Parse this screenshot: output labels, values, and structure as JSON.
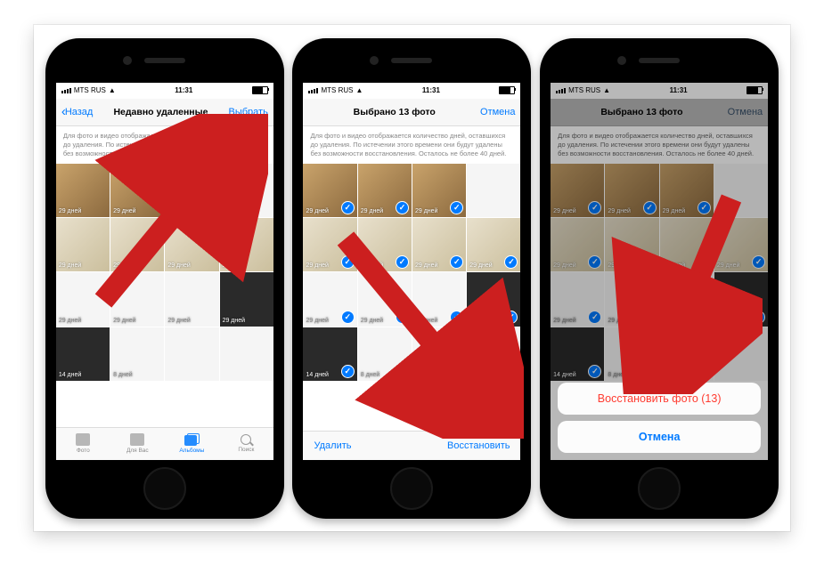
{
  "status": {
    "carrier": "MTS RUS",
    "wifi_icon": "wifi",
    "time": "11:31",
    "battery_icon": "battery"
  },
  "description": "Для фото и видео отображается количество дней, оставшихся до удаления. По истечении этого времени они будут удалены без возможности восстановления. Осталось не более 40 дней.",
  "day_labels": {
    "d29": "29 дней",
    "d14": "14 дней",
    "d8": "8 дней"
  },
  "phone1": {
    "nav_back": "Назад",
    "nav_title": "Недавно удаленные",
    "nav_action": "Выбрать",
    "tabs": {
      "photos": "Фото",
      "for_you": "Для Вас",
      "albums": "Альбомы",
      "search": "Поиск"
    }
  },
  "phone2": {
    "nav_title": "Выбрано 13 фото",
    "nav_action": "Отмена",
    "toolbar_delete": "Удалить",
    "toolbar_recover": "Восстановить"
  },
  "phone3": {
    "nav_title": "Выбрано 13 фото",
    "nav_action": "Отмена",
    "sheet_recover": "Восстановить фото (13)",
    "sheet_cancel": "Отмена"
  }
}
